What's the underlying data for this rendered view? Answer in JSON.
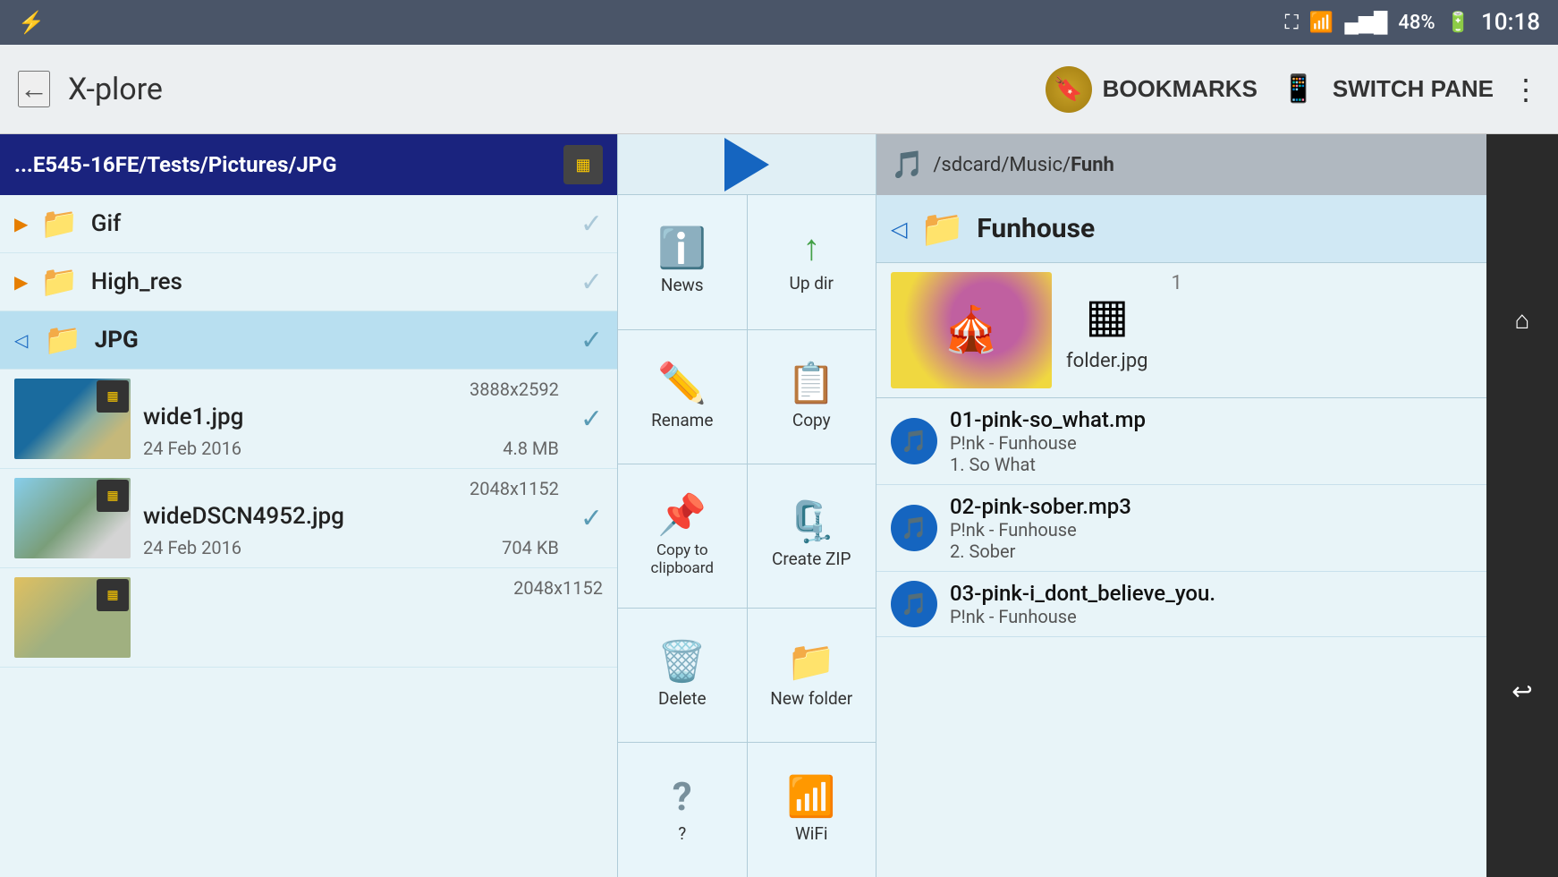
{
  "statusBar": {
    "battery": "48%",
    "time": "10:18",
    "usbSymbol": "⚡"
  },
  "topBar": {
    "backLabel": "←",
    "appTitle": "X-plore",
    "bookmarksLabel": "BOOKMARKS",
    "switchPaneLabel": "SWITCH PANE",
    "moreLabel": "⋮"
  },
  "leftPane": {
    "headerPath": "...E545-16FE/Tests/Pictures/",
    "headerBold": "JPG",
    "folders": [
      {
        "name": "Gif",
        "checked": false
      },
      {
        "name": "High_res",
        "checked": false
      },
      {
        "name": "JPG",
        "checked": true,
        "selected": true
      }
    ],
    "files": [
      {
        "name": "wide1.jpg",
        "dims": "3888x2592",
        "date": "24 Feb 2016",
        "size": "4.8 MB",
        "type": "beach",
        "checked": true
      },
      {
        "name": "wideDSCN4952.jpg",
        "dims": "2048x1152",
        "date": "24 Feb 2016",
        "size": "704 KB",
        "type": "statue",
        "checked": true
      },
      {
        "name": "...",
        "dims": "2048x1152",
        "date": "",
        "size": "",
        "type": "third",
        "checked": false
      }
    ]
  },
  "contextMenu": {
    "items": [
      {
        "id": "news",
        "label": "News",
        "icon": "ℹ️",
        "iconClass": "icon-news"
      },
      {
        "id": "updir",
        "label": "Up dir",
        "icon": "↑",
        "iconClass": "icon-updir"
      },
      {
        "id": "rename",
        "label": "Rename",
        "icon": "✏️",
        "iconClass": "icon-rename"
      },
      {
        "id": "copy",
        "label": "Copy",
        "icon": "📋",
        "iconClass": "icon-copy"
      },
      {
        "id": "clipboard",
        "label": "Copy to clipboard",
        "icon": "📌",
        "iconClass": "icon-clipboard"
      },
      {
        "id": "zip",
        "label": "Create ZIP",
        "icon": "🗜️",
        "iconClass": "icon-zip"
      },
      {
        "id": "delete",
        "label": "Delete",
        "icon": "🗑️",
        "iconClass": "icon-delete"
      },
      {
        "id": "newfolder",
        "label": "New folder",
        "icon": "📁",
        "iconClass": "icon-newfolder"
      },
      {
        "id": "help",
        "label": "?",
        "icon": "❓",
        "iconClass": "icon-help"
      },
      {
        "id": "wifi",
        "label": "WiFi",
        "icon": "📶",
        "iconClass": "icon-wifi"
      }
    ]
  },
  "rightPane": {
    "headerPath": "/sdcard/Music/",
    "headerBold": "Funh",
    "folderName": "Funhouse",
    "folderJpgName": "folder.jpg",
    "pageNum": "1",
    "musicItems": [
      {
        "filename": "01-pink-so_what.mp",
        "artist": "P!nk - Funhouse",
        "track": "1.  So What"
      },
      {
        "filename": "02-pink-sober.mp3",
        "artist": "P!nk - Funhouse",
        "track": "2.  Sober"
      },
      {
        "filename": "03-pink-i_dont_believe_you.",
        "artist": "P!nk - Funhouse",
        "track": ""
      }
    ]
  },
  "rightEdge": {
    "homeLabel": "⌂",
    "backLabel": "↩"
  }
}
